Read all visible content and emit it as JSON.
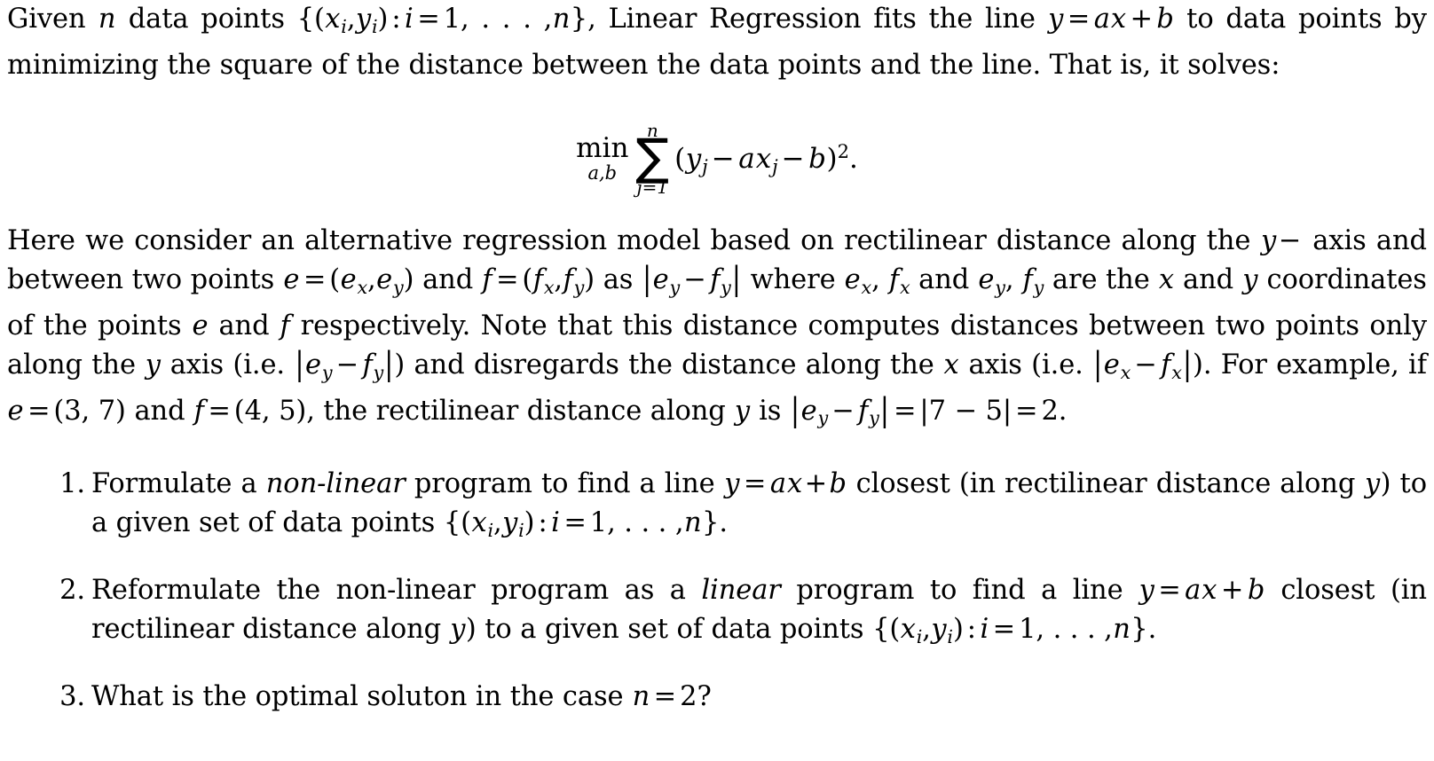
{
  "document": {
    "type": "latex-math-problem-statement",
    "paragraphs": [
      {
        "id": "intro",
        "text": "Given n data points {(xi, yi) : i = 1, . . . , n}, Linear Regression fits the line y = ax + b to data points by minimizing the square of the distance between the data points and the line. That is, it solves:"
      },
      {
        "id": "alternative-model",
        "text": "Here we consider an alternative regression model based on rectilinear distance along the y− axis and between two points e = (ex, ey) and f = (fx, fy) as |ey − fy| where ex, fx and ey, fy are the x and y coordinates of the points e and f respectively. Note that this distance computes distances between two points only along the y axis (i.e. |ey − fy|) and disregards the distance along the x axis (i.e. |ex − fx|). For example, if e = (3, 7) and f = (4, 5), the rectilinear distance along y is |ey − fy| = |7 − 5| = 2."
      }
    ],
    "intro_tokens": {
      "t1": "Given",
      "var_n": "n",
      "t2": "data points",
      "brace_open": "{(",
      "var_x": "x",
      "sub_i": "i",
      "comma": ",",
      "var_y": "y",
      "paren_close": ")",
      "colon": ":",
      "var_i": "i",
      "eq": "=",
      "one": "1",
      "dots": ", . . . ,",
      "brace_close": "}",
      "t3": ", Linear Regression fits the line",
      "var_a": "a",
      "plus": "+",
      "var_b": "b",
      "t4": "to data points by minimizing the square of the distance between the data points and the line. That is, it solves:"
    },
    "equation": {
      "id": "least-squares-objective",
      "latex": "\\min_{a,b} \\sum_{j=1}^{n} (y_j - a x_j - b)^2.",
      "plain": "min_{a,b} sum_{j=1}^{n} (y_j - a x_j - b)^2.",
      "min_operator": "min",
      "min_subscript": "a,b",
      "sum_symbol": "∑",
      "sum_lower": "j=1",
      "sum_upper": "n",
      "summand_open": "(",
      "summand": "y_j − ax_j − b",
      "summand_close": ")",
      "exponent": "2",
      "period": "."
    },
    "para2_tokens": {
      "s1": "Here we consider an alternative regression model based on rectilinear distance along the",
      "y": "y",
      "minus": "−",
      "axis": "axis",
      "s2": "and between two points",
      "e": "e",
      "eq": "=",
      "f": "f",
      "as": "as",
      "where": "where",
      "and": "and",
      "are_the": "are the",
      "x": "x",
      "s3": "and",
      "s4": "coordinates of the points",
      "s5": "and",
      "s6": "respectively. Note that this distance computes distances between two points only along the",
      "s7": "axis (i.e.",
      "s8": ") and disregards the distance along the",
      "s9": "axis (i.e.",
      "s10": "). For example, if",
      "pt_e": "(3, 7)",
      "s11": "and",
      "pt_f": "(4, 5)",
      "s12": ", the rectilinear distance along",
      "s13": "is",
      "ex_value_1": "|7 − 5|",
      "ex_value_2": "2",
      "period": "."
    },
    "list": {
      "items": [
        {
          "marker": "1.",
          "id": "question-1",
          "text": "Formulate a non-linear program to find a line y = ax + b closest (in rectilinear distance along y) to a given set of data points {(xi, yi) : i = 1, . . . , n}.",
          "emphasis": "non-linear",
          "parts": {
            "p1": "Formulate a",
            "em": "non-linear",
            "p2": "program to find a line",
            "p3": "closest (in rectilinear distance along",
            "p4": ") to a given set of data points"
          }
        },
        {
          "marker": "2.",
          "id": "question-2",
          "text": "Reformulate the non-linear program as a linear program to find a line y = ax + b closest (in rectilinear distance along y) to a given set of data points {(xi, yi) : i = 1, . . . , n}.",
          "emphasis": "linear",
          "parts": {
            "p1": "Reformulate the non-linear program as a",
            "em": "linear",
            "p2": "program to find a line",
            "p3": "closest (in rectilinear distance along",
            "p4": ") to a given set of data points"
          }
        },
        {
          "marker": "3.",
          "id": "question-3",
          "text": "What is the optimal soluton in the case n = 2?",
          "parts": {
            "p1": "What is the optimal soluton in the case",
            "var": "n",
            "eq": "=",
            "val": "2?"
          }
        }
      ]
    },
    "colors": {
      "text": "#000000",
      "background": "#ffffff"
    }
  }
}
